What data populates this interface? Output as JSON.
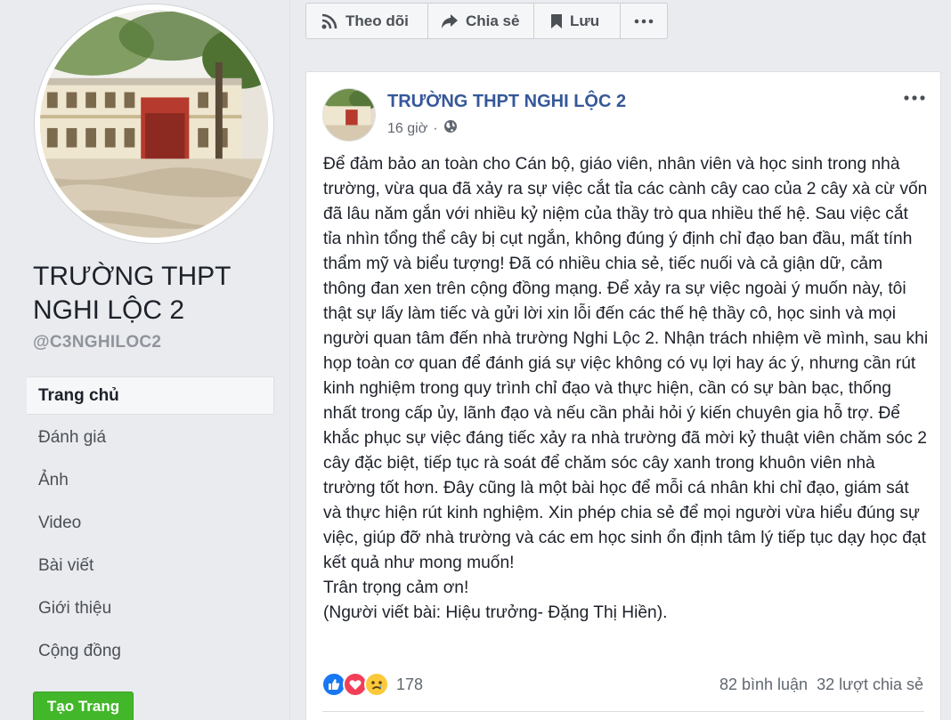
{
  "sidebar": {
    "page_name": "TRƯỜNG THPT NGHI LỘC 2",
    "handle": "@C3NGHILOC2",
    "nav": [
      {
        "label": "Trang chủ"
      },
      {
        "label": "Đánh giá"
      },
      {
        "label": "Ảnh"
      },
      {
        "label": "Video"
      },
      {
        "label": "Bài viết"
      },
      {
        "label": "Giới thiệu"
      },
      {
        "label": "Cộng đồng"
      }
    ],
    "create_page": "Tạo Trang"
  },
  "actions": {
    "follow": "Theo dõi",
    "share": "Chia sẻ",
    "save": "Lưu"
  },
  "post": {
    "author": "TRƯỜNG THPT NGHI LỘC 2",
    "time": "16 giờ",
    "separator": "·",
    "body": [
      "Để đảm bảo an toàn cho Cán bộ, giáo viên, nhân viên và học sinh trong nhà trường, vừa qua đã xảy ra sự việc cắt tỉa các cành cây cao của 2 cây xà cừ vốn đã lâu năm gắn với nhiều kỷ niệm của thầy trò qua nhiều thế hệ. Sau việc cắt tỉa nhìn tổng thể cây bị cụt ngắn, không đúng ý định chỉ đạo ban đầu, mất tính thẩm mỹ và biểu tượng! Đã có nhiều chia sẻ, tiếc nuối và cả giận dữ, cảm thông đan xen trên cộng đồng mạng. Để xảy ra sự việc ngoài ý muốn này, tôi thật sự lấy làm tiếc và gửi lời xin lỗi đến các thế hệ thầy cô, học sinh và mọi người quan tâm đến nhà trường Nghi Lộc 2. Nhận trách nhiệm về mình, sau khi họp toàn cơ quan để đánh giá sự việc không có vụ lợi hay ác ý, nhưng cần rút kinh nghiệm trong quy trình chỉ đạo và thực hiện, cần có sự bàn bạc, thống nhất trong cấp ủy, lãnh đạo và nếu cần phải hỏi ý kiến chuyên gia hỗ trợ. Để khắc phục sự việc đáng tiếc xảy ra nhà trường đã mời kỷ thuật viên chăm sóc 2 cây đặc biệt, tiếp tục rà soát để chăm sóc cây xanh trong khuôn viên nhà trường tốt hơn. Đây cũng là một bài học để mỗi cá nhân khi chỉ đạo, giám sát và thực hiện rút kinh nghiệm. Xin phép chia sẻ để mọi người vừa hiểu đúng sự việc, giúp đỡ nhà trường và các em học sinh ổn định tâm lý tiếp tục dạy học đạt kết quả như mong muốn!",
      "Trân trọng cảm ơn!",
      "(Người viết bài: Hiệu trưởng- Đặng Thị Hiền)."
    ],
    "reaction_count": "178",
    "comments": "82 bình luận",
    "shares": "32 lượt chia sẻ"
  },
  "colors": {
    "link_blue": "#365899",
    "create_green": "#42b72a",
    "like_blue": "#1877f2",
    "love_red": "#f33e58",
    "sad_yellow": "#fcc93b"
  },
  "icons": [
    "rss-icon",
    "share-arrow-icon",
    "bookmark-icon",
    "more-dots-icon",
    "globe-icon",
    "like-icon",
    "love-icon",
    "sad-icon"
  ]
}
